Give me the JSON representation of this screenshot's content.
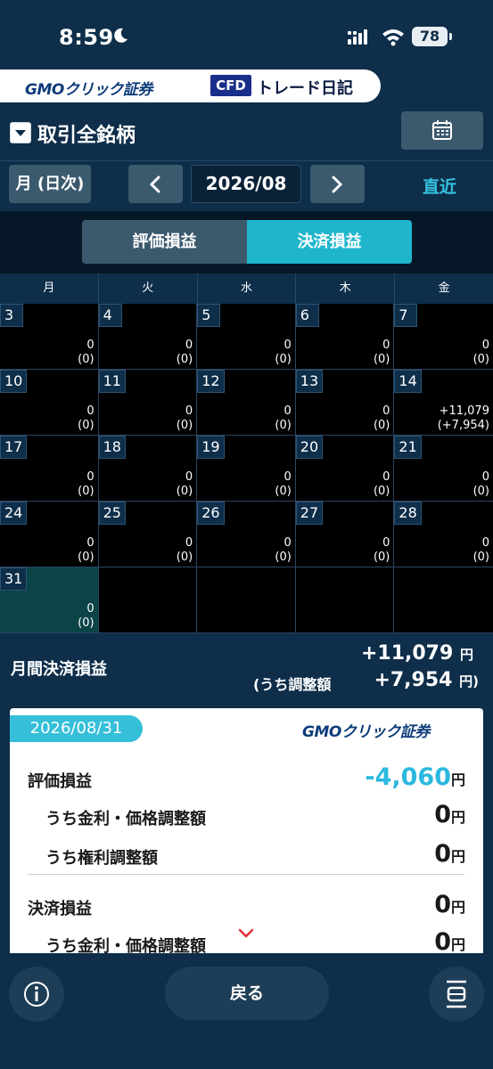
{
  "status_bar": {
    "time": "8:59",
    "battery": "78"
  },
  "brand": {
    "logo": "GMOクリック証券",
    "badge": "CFD",
    "title": "トレード日記"
  },
  "symbol_filter": {
    "label": "取引全銘柄"
  },
  "nav": {
    "mode_label": "月 (日次)",
    "month": "2026/08",
    "recent_label": "直近"
  },
  "toggle": {
    "unrealized_label": "評価損益",
    "realized_label": "決済損益"
  },
  "calendar": {
    "weekdays": [
      "月",
      "火",
      "水",
      "木",
      "金"
    ],
    "weeks": [
      [
        {
          "day": "3",
          "pl": "0",
          "adj": "(0)"
        },
        {
          "day": "4",
          "pl": "0",
          "adj": "(0)"
        },
        {
          "day": "5",
          "pl": "0",
          "adj": "(0)"
        },
        {
          "day": "6",
          "pl": "0",
          "adj": "(0)"
        },
        {
          "day": "7",
          "pl": "0",
          "adj": "(0)"
        }
      ],
      [
        {
          "day": "10",
          "pl": "0",
          "adj": "(0)"
        },
        {
          "day": "11",
          "pl": "0",
          "adj": "(0)"
        },
        {
          "day": "12",
          "pl": "0",
          "adj": "(0)"
        },
        {
          "day": "13",
          "pl": "0",
          "adj": "(0)"
        },
        {
          "day": "14",
          "pl": "+11,079",
          "adj": "(+7,954)"
        }
      ],
      [
        {
          "day": "17",
          "pl": "0",
          "adj": "(0)"
        },
        {
          "day": "18",
          "pl": "0",
          "adj": "(0)"
        },
        {
          "day": "19",
          "pl": "0",
          "adj": "(0)"
        },
        {
          "day": "20",
          "pl": "0",
          "adj": "(0)"
        },
        {
          "day": "21",
          "pl": "0",
          "adj": "(0)"
        }
      ],
      [
        {
          "day": "24",
          "pl": "0",
          "adj": "(0)"
        },
        {
          "day": "25",
          "pl": "0",
          "adj": "(0)"
        },
        {
          "day": "26",
          "pl": "0",
          "adj": "(0)"
        },
        {
          "day": "27",
          "pl": "0",
          "adj": "(0)"
        },
        {
          "day": "28",
          "pl": "0",
          "adj": "(0)"
        }
      ],
      [
        {
          "day": "31",
          "pl": "0",
          "adj": "(0)"
        },
        {
          "day": "",
          "pl": "",
          "adj": ""
        },
        {
          "day": "",
          "pl": "",
          "adj": ""
        },
        {
          "day": "",
          "pl": "",
          "adj": ""
        },
        {
          "day": "",
          "pl": "",
          "adj": ""
        }
      ]
    ]
  },
  "monthly_summary": {
    "label": "月間決済損益",
    "total": "+11,079",
    "adjust_label": "(うち調整額",
    "adjust_value": "+7,954",
    "unit": "円",
    "adjust_unit": "円)"
  },
  "detail": {
    "date": "2026/08/31",
    "logo": "GMOクリック証券",
    "unit": "円",
    "unrealized": {
      "label": "評価損益",
      "value": "-4,060"
    },
    "unrealized_interest": {
      "label": "うち金利・価格調整額",
      "value": "0"
    },
    "unrealized_rights": {
      "label": "うち権利調整額",
      "value": "0"
    },
    "realized": {
      "label": "決済損益",
      "value": "0"
    },
    "realized_interest": {
      "label": "うち金利・価格調整額",
      "value": "0"
    }
  },
  "bottom": {
    "back_label": "戻る"
  }
}
